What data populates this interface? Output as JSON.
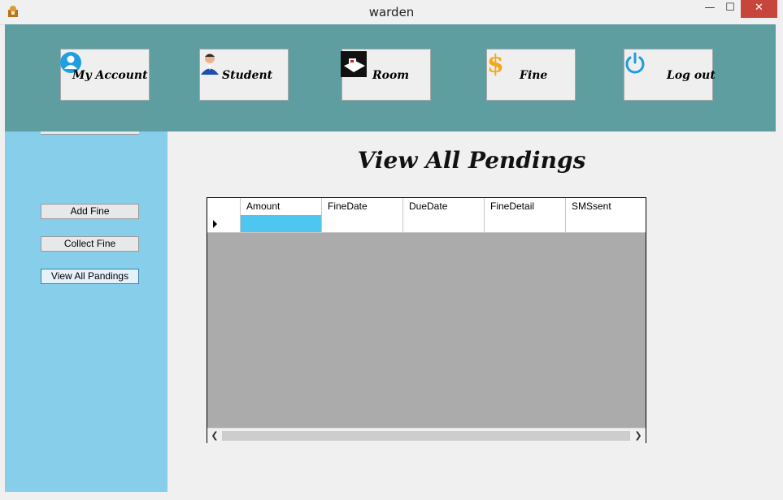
{
  "window": {
    "title": "warden"
  },
  "controls": {
    "minimize": "—",
    "maximize": "☐",
    "close": "✕"
  },
  "nav": [
    {
      "label": "My Account",
      "icon": "user-circle-icon"
    },
    {
      "label": "Student",
      "icon": "student-icon"
    },
    {
      "label": "Room",
      "icon": "room-icon"
    },
    {
      "label": "Fine",
      "icon": "dollar-icon"
    },
    {
      "label": "Log out",
      "icon": "power-icon"
    }
  ],
  "sidebar": {
    "buttons": [
      "Add Fine",
      "Collect Fine",
      "View All Pandings"
    ]
  },
  "main": {
    "title": "View All Pendings"
  },
  "grid": {
    "columns": [
      "Amount",
      "FineDate",
      "DueDate",
      "FineDetail",
      "SMSsent"
    ]
  },
  "colors": {
    "header": "#5f9ea0",
    "sidebar": "#87ceeb",
    "grid_background": "#ababab",
    "selected_cell": "#4fc6ef"
  }
}
